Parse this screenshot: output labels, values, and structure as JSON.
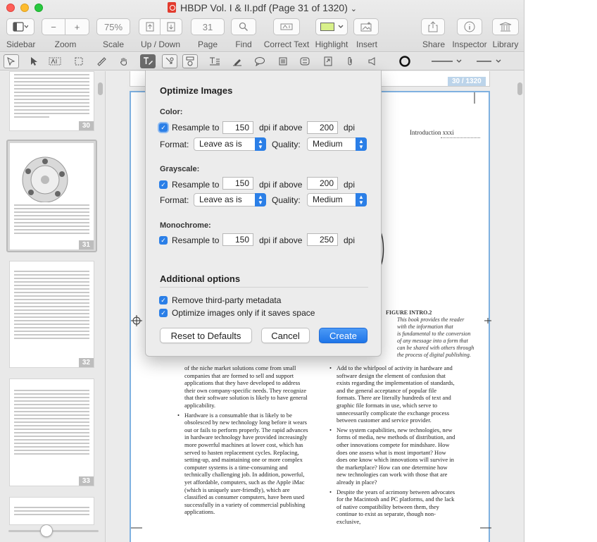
{
  "window": {
    "title": "HBDP Vol. I & II.pdf (Page 31 of 1320)",
    "title_chevron": "⌄"
  },
  "toolbar": {
    "sidebar_label": "Sidebar",
    "zoom_label": "Zoom",
    "zoom_out": "−",
    "zoom_in": "+",
    "scale_label": "Scale",
    "scale_value": "75%",
    "updown_label": "Up / Down",
    "page_label": "Page",
    "page_value": "31",
    "find_label": "Find",
    "correct_text_label": "Correct Text",
    "highlight_label": "Highlight",
    "insert_label": "Insert",
    "share_label": "Share",
    "inspector_label": "Inspector",
    "library_label": "Library"
  },
  "sidebar": {
    "thumbnails": [
      {
        "page": "30"
      },
      {
        "page": "31"
      },
      {
        "page": "32"
      },
      {
        "page": "33"
      }
    ]
  },
  "document": {
    "page_badge": "30 / 1320",
    "running_head": "Introduction   xxxi",
    "figure_title": "FIGURE INTRO.2",
    "figure_lines": [
      "This book provides the reader",
      "with the information that",
      "is fundamental to the conversion",
      "of any message into a form that",
      "can be shared with others through",
      "the process of digital publishing."
    ],
    "left_col": [
      "of the niche market solutions come from small companies that are formed to sell and support applications that they have developed to address their own company-specific needs. They recognize that their software solution is likely to have general applicability.",
      "Hardware is a consumable that is likely to be obsolesced by new technology long before it wears out or fails to perform properly. The rapid advances in hardware technology have provided increasingly more powerful machines at lower cost, which has served to hasten replacement cycles. Replacing, setting-up, and maintaining one or more complex computer systems is a time-consuming and technically challenging job. In addition, powerful, yet affordable, computers, such as the Apple iMac (which is uniquely user-friendly), which are classified as consumer computers, have been used successfully in a variety of commercial publishing applications."
    ],
    "right_col": [
      "Add to the whirlpool of activity in hardware and software design the element of confusion that exists regarding the implementation of standards, and the general acceptance of popular file formats. There are literally hundreds of text and graphic file formats in use, which serve to unnecessarily complicate the exchange process between customer and service provider.",
      "New system capabilities, new technologies, new forms of media, new methods of distribution, and other innovations compete for mindshare. How does one assess what is most important? How does one know which innovations will survive in the marketplace? How can one determine how new technologies can work with those that are already in place?",
      "Despite the years of acrimony between advocates for the Macintosh and PC platforms, and the lack of native compatibility between them, they continue to exist as separate, though non-exclusive,"
    ]
  },
  "dialog": {
    "title": "Optimize Images",
    "color": {
      "heading": "Color:",
      "resample_label": "Resample to",
      "resample_value": "150",
      "dpi_if_above": "dpi if above",
      "above_value": "200",
      "dpi": "dpi",
      "format_label": "Format:",
      "format_value": "Leave as is",
      "quality_label": "Quality:",
      "quality_value": "Medium"
    },
    "grayscale": {
      "heading": "Grayscale:",
      "resample_label": "Resample to",
      "resample_value": "150",
      "dpi_if_above": "dpi if above",
      "above_value": "200",
      "dpi": "dpi",
      "format_label": "Format:",
      "format_value": "Leave as is",
      "quality_label": "Quality:",
      "quality_value": "Medium"
    },
    "monochrome": {
      "heading": "Monochrome:",
      "resample_label": "Resample to",
      "resample_value": "150",
      "dpi_if_above": "dpi if above",
      "above_value": "250",
      "dpi": "dpi"
    },
    "additional": {
      "heading": "Additional options",
      "remove_metadata": "Remove third-party metadata",
      "optimize_only": "Optimize images only if it saves space"
    },
    "buttons": {
      "reset": "Reset to Defaults",
      "cancel": "Cancel",
      "create": "Create"
    },
    "check_mark": "✓"
  },
  "colors": {
    "accent": "#2b7fe7",
    "page_border": "#7fb1e0",
    "highlight_swatch": "#d8f08a"
  }
}
